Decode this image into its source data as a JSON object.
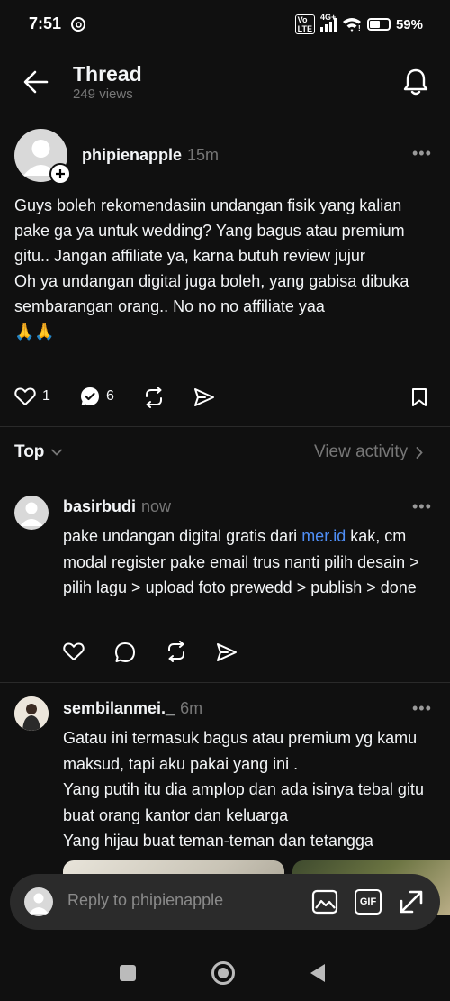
{
  "status_bar": {
    "time": "7:51",
    "battery": "59%",
    "network": "4G+"
  },
  "header": {
    "title": "Thread",
    "views": "249 views"
  },
  "post": {
    "username": "phipienapple",
    "time": "15m",
    "text": "Guys boleh rekomendasiin undangan fisik yang kalian pake ga ya untuk wedding? Yang bagus atau premium gitu.. Jangan affiliate ya, karna butuh review jujur\nOh ya undangan digital juga boleh, yang gabisa dibuka sembarangan orang.. No no no affiliate yaa\n🙏🙏",
    "likes": "1",
    "replies": "6"
  },
  "sort": {
    "label": "Top",
    "view_activity": "View activity"
  },
  "replies": [
    {
      "username": "basirbudi",
      "time": "now",
      "text_before_link": "pake undangan digital gratis dari ",
      "link": "mer.id",
      "text_after_link": " kak, cm modal register pake email trus nanti pilih desain > pilih lagu > upload foto prewedd > publish > done"
    },
    {
      "username": "sembilanmei._",
      "time": "6m",
      "text": "Gatau ini termasuk bagus atau premium yg kamu maksud, tapi aku pakai yang ini .\nYang putih itu dia amplop dan ada isinya tebal gitu buat orang kantor dan keluarga\nYang hijau buat teman-teman dan tetangga"
    }
  ],
  "composer": {
    "placeholder": "Reply to phipienapple",
    "gif_label": "GIF"
  },
  "colors": {
    "background": "#101010",
    "text": "#f3f5f7",
    "muted": "#777777",
    "link": "#4f8ef5",
    "composer": "#2b2b2b"
  },
  "icons": [
    "back-arrow-icon",
    "bell-icon",
    "heart-icon",
    "reply-check-icon",
    "repost-icon",
    "share-icon",
    "bookmark-icon",
    "chevron-down-icon",
    "chevron-right-icon",
    "comment-icon",
    "image-icon",
    "gif-icon",
    "expand-icon"
  ]
}
